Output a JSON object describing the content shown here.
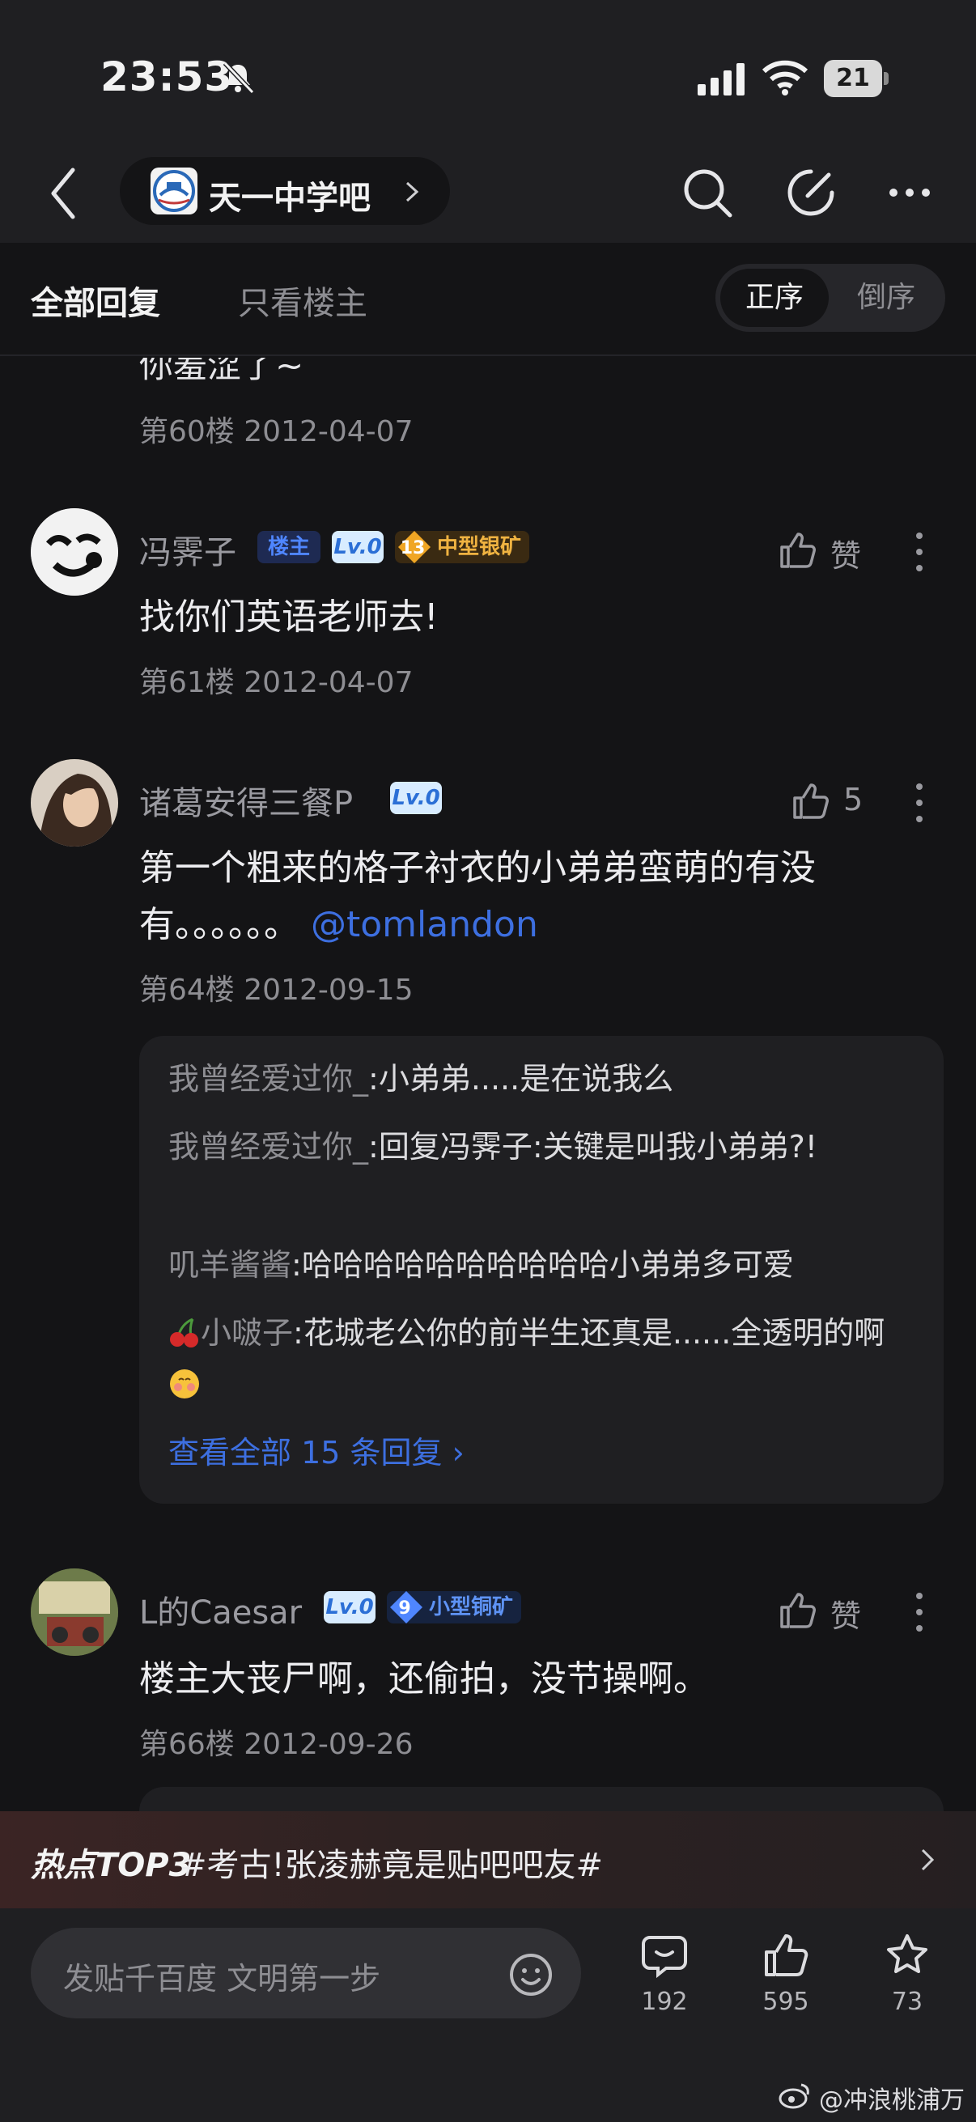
{
  "status": {
    "time": "23:53",
    "battery": "21"
  },
  "nav": {
    "forum_name": "天一中学吧"
  },
  "tabs": {
    "all": "全部回复",
    "owner_only": "只看楼主",
    "sort_asc": "正序",
    "sort_desc": "倒序"
  },
  "prev_post": {
    "tail_text": "你羞涩了~",
    "meta": "第60楼 2012-04-07"
  },
  "posts": [
    {
      "user": "冯霁子",
      "badges": {
        "owner": "楼主",
        "lv": "Lv.0",
        "mine_level": "13",
        "mine_name": "中型银矿"
      },
      "like_label": "赞",
      "text": "找你们英语老师去!",
      "meta": "第61楼 2012-04-07"
    },
    {
      "user": "诸葛安得三餐P",
      "badges": {
        "lv": "Lv.0"
      },
      "like_label": "5",
      "text_line1": "第一个粗来的格子衬衣的小弟弟蛮萌的有没",
      "text_line2": "有。。。。。。",
      "mention": "@tomlandon",
      "meta": "第64楼 2012-09-15",
      "replies": [
        {
          "who": "我曾经爱过你_",
          "text": ":小弟弟.....是在说我么"
        },
        {
          "who": "我曾经爱过你_",
          "text": ":回复冯霁子:关键是叫我小弟弟?!"
        },
        {
          "who": "叽羊酱酱",
          "text": ":哈哈哈哈哈哈哈哈哈哈小弟弟多可爱"
        },
        {
          "who": "小啵子",
          "text": ":花城老公你的前半生还真是......全透明的啊"
        }
      ],
      "view_all": "查看全部 15 条回复 ›"
    },
    {
      "user": "L的Caesar",
      "badges": {
        "lv": "Lv.0",
        "mine_level": "9",
        "mine_name": "小型铜矿"
      },
      "like_label": "赞",
      "text": "楼主大丧尸啊，还偷拍，没节操啊。",
      "meta": "第66楼 2012-09-26"
    }
  ],
  "hot": {
    "label": "热点TOP3",
    "text": "#考古!张凌赫竟是贴吧吧友#"
  },
  "bottom": {
    "placeholder": "发贴千百度 文明第一步",
    "comments": "192",
    "likes": "595",
    "favorites": "73"
  },
  "watermark": "@冲浪桃浦万",
  "colors": {
    "accent": "#3d6fe0",
    "background": "#141416",
    "surface": "#1f1f22"
  }
}
